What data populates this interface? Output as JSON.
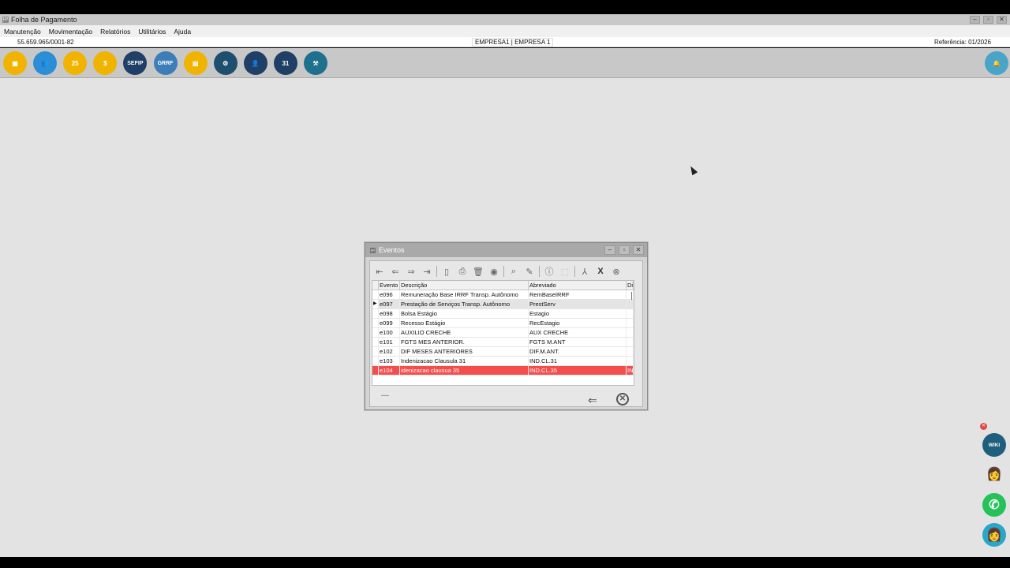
{
  "window": {
    "title": "Folha de Pagamento"
  },
  "menu": [
    "Manutenção",
    "Movimentação",
    "Relatórios",
    "Utilitários",
    "Ajuda"
  ],
  "info": {
    "cnpj": "55.659.965/0001-82",
    "empresa": "EMPRESA1 | EMPRESA 1",
    "referencia": "Referência: 01/2026"
  },
  "toolbar_icons": [
    {
      "name": "company-icon",
      "color": "#f0b400",
      "glyph": "▣"
    },
    {
      "name": "employees-icon",
      "color": "#2c8fd6",
      "glyph": "👥"
    },
    {
      "name": "calendar-25-icon",
      "color": "#f0b400",
      "glyph": "25"
    },
    {
      "name": "money-icon",
      "color": "#f0b400",
      "glyph": "$"
    },
    {
      "name": "sefip-icon",
      "color": "#1f3f66",
      "label": "SEFIP"
    },
    {
      "name": "grrf-icon",
      "color": "#3d7eb8",
      "label": "GRRF"
    },
    {
      "name": "document-icon",
      "color": "#f0b400",
      "glyph": "▤"
    },
    {
      "name": "user-settings-icon",
      "color": "#1f4f6e",
      "glyph": "⚙"
    },
    {
      "name": "worker-icon",
      "color": "#1f3f66",
      "glyph": "👤"
    },
    {
      "name": "calendar-31-icon",
      "color": "#1f3f66",
      "glyph": "31"
    },
    {
      "name": "gavel-icon",
      "color": "#1f6f8e",
      "glyph": "⚒"
    }
  ],
  "notification_icon": "bell-icon",
  "dialog": {
    "title": "Eventos",
    "columns": [
      "Evento",
      "Descrição",
      "Abreviado",
      "Di"
    ],
    "rows": [
      {
        "evento": "e096",
        "descricao": "Remuneração Base IRRF Transp. Autônomo",
        "abreviado": "RemBaseIRRF",
        "di": ""
      },
      {
        "evento": "e097",
        "descricao": "Prestação de Serviços Transp. Autônomo",
        "abreviado": "PrestServ",
        "di": ""
      },
      {
        "evento": "e098",
        "descricao": "Bolsa Estágio",
        "abreviado": "Estagio",
        "di": ""
      },
      {
        "evento": "e099",
        "descricao": "Recesso Estágio",
        "abreviado": "RecEstagio",
        "di": ""
      },
      {
        "evento": "e100",
        "descricao": "AUXILIO CRECHE",
        "abreviado": "AUX CRECHE",
        "di": ""
      },
      {
        "evento": "e101",
        "descricao": "FGTS MES ANTERIOR.",
        "abreviado": "FGTS M.ANT",
        "di": ""
      },
      {
        "evento": "e102",
        "descricao": "DIF MESES ANTERIORES",
        "abreviado": "DIF.M.ANT.",
        "di": ""
      },
      {
        "evento": "e103",
        "descricao": "Indenizacao Clausula 31",
        "abreviado": "IND.CL.31",
        "di": ""
      },
      {
        "evento": "e104",
        "descricao": "idenizacao clausua 35",
        "abreviado": "IND.CL.35",
        "di": "IN"
      }
    ]
  },
  "side_buttons": [
    {
      "name": "wiki-icon",
      "color": "#1f5f7e",
      "label": "WIKI"
    },
    {
      "name": "assistant-avatar-icon",
      "color": "#e3e3e3",
      "glyph": "👩"
    },
    {
      "name": "whatsapp-icon",
      "color": "#25c25a",
      "glyph": "✆"
    },
    {
      "name": "support-avatar-icon",
      "color": "#2aa6c9",
      "glyph": "👩"
    }
  ],
  "colors": {
    "highlight_row": "#f44d4d",
    "desktop": "#e3e3e3"
  }
}
